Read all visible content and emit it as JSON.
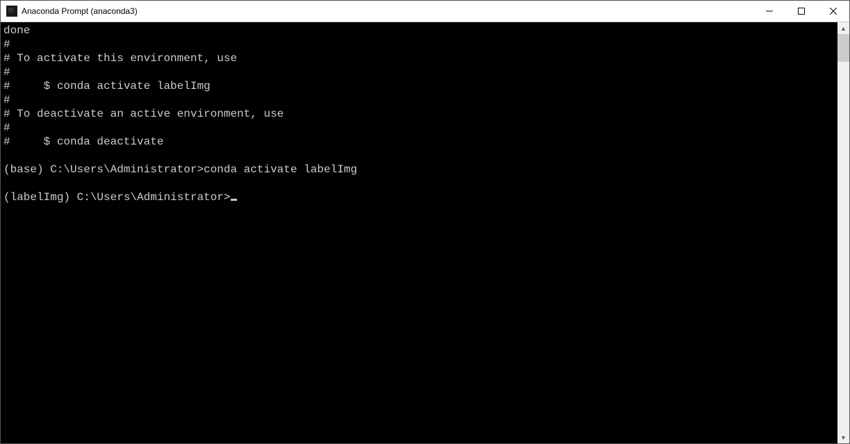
{
  "window": {
    "title": "Anaconda Prompt (anaconda3)"
  },
  "terminal": {
    "lines": [
      "done",
      "#",
      "# To activate this environment, use",
      "#",
      "#     $ conda activate labelImg",
      "#",
      "# To deactivate an active environment, use",
      "#",
      "#     $ conda deactivate",
      "",
      "(base) C:\\Users\\Administrator>conda activate labelImg",
      ""
    ],
    "current_prompt": "(labelImg) C:\\Users\\Administrator>"
  }
}
